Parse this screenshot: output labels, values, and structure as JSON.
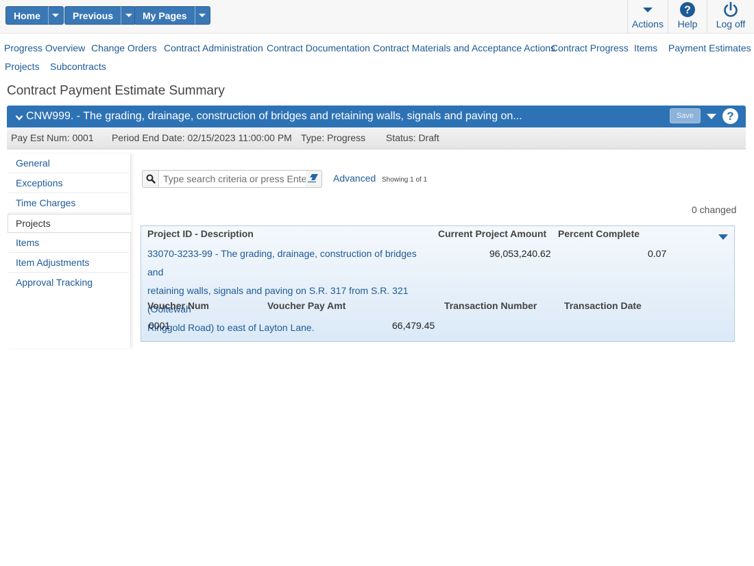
{
  "topbar": {
    "home_label": "Home",
    "previous_label": "Previous",
    "mypages_label": "My Pages",
    "actions_label": "Actions",
    "help_label": "Help",
    "logoff_label": "Log off"
  },
  "nav": {
    "links": [
      "Progress Overview",
      "Change Orders",
      "Contract Administration",
      "Contract Documentation",
      "Contract Materials and Acceptance Actions",
      "Contract Progress",
      "Items",
      "Payment Estimates",
      "Projects",
      "Subcontracts"
    ]
  },
  "page": {
    "title": "Contract Payment Estimate Summary"
  },
  "contract": {
    "title": "CNW999. - The grading, drainage, construction of bridges and retaining walls, signals and paving on...",
    "save_label": "Save",
    "pay_est_num": "Pay Est Num: 0001",
    "period_end": "Period End Date: 02/15/2023 11:00:00 PM",
    "type": "Type: Progress",
    "status": "Status: Draft"
  },
  "sidebar": {
    "items": [
      "General",
      "Exceptions",
      "Time Charges",
      "Projects",
      "Items",
      "Item Adjustments",
      "Approval Tracking"
    ],
    "active": "Projects"
  },
  "search": {
    "placeholder": "Type search criteria or press Enter",
    "advanced_label": "Advanced",
    "showing": "Showing 1 of 1",
    "changed": "0 changed"
  },
  "grid": {
    "headers": {
      "project": "Project ID - Description",
      "current_amount": "Current Project Amount",
      "percent": "Percent Complete"
    },
    "row": {
      "description_lines": [
        "33070-3233-99 - The grading, drainage, construction of bridges and",
        "retaining walls, signals and paving on S.R. 317 from S.R. 321 (Ooltewah",
        "Ringgold Road) to east of Layton Lane."
      ],
      "current_amount": "96,053,240.62",
      "percent": "0.07"
    },
    "voucher_headers": {
      "num": "Voucher Num",
      "pay_amt": "Voucher Pay Amt",
      "trans_num": "Transaction Number",
      "trans_date": "Transaction Date"
    },
    "voucher": {
      "num": "0001",
      "pay_amt": "66,479.45"
    }
  },
  "colors": {
    "primary": "#2d72b4",
    "button": "#3a78b5",
    "link": "#1d5a96"
  }
}
